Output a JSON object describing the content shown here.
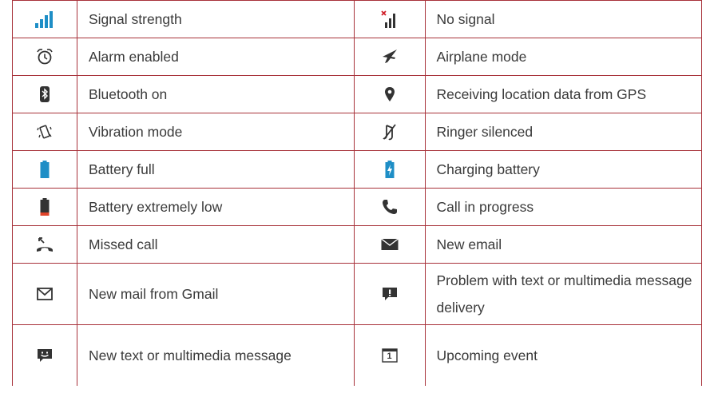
{
  "rows": [
    {
      "left": {
        "icon": "signal-strength-icon",
        "label": "Signal strength"
      },
      "right": {
        "icon": "no-signal-icon",
        "label": "No signal"
      }
    },
    {
      "left": {
        "icon": "alarm-icon",
        "label": "Alarm enabled"
      },
      "right": {
        "icon": "airplane-icon",
        "label": "Airplane mode"
      }
    },
    {
      "left": {
        "icon": "bluetooth-icon",
        "label": "Bluetooth on"
      },
      "right": {
        "icon": "gps-location-icon",
        "label": "Receiving location data from GPS"
      }
    },
    {
      "left": {
        "icon": "vibration-icon",
        "label": "Vibration mode"
      },
      "right": {
        "icon": "ringer-silenced-icon",
        "label": "Ringer silenced"
      }
    },
    {
      "left": {
        "icon": "battery-full-icon",
        "label": "Battery full"
      },
      "right": {
        "icon": "battery-charging-icon",
        "label": "Charging battery"
      }
    },
    {
      "left": {
        "icon": "battery-low-icon",
        "label": "Battery extremely low"
      },
      "right": {
        "icon": "call-in-progress-icon",
        "label": "Call in progress"
      }
    },
    {
      "left": {
        "icon": "missed-call-icon",
        "label": "Missed call"
      },
      "right": {
        "icon": "new-email-icon",
        "label": "New email"
      }
    },
    {
      "left": {
        "icon": "gmail-icon",
        "label": "New mail from Gmail"
      },
      "right": {
        "icon": "message-error-icon",
        "label": "Problem with text or multimedia message delivery"
      }
    },
    {
      "left": {
        "icon": "new-message-icon",
        "label": "New text or multimedia message"
      },
      "right": {
        "icon": "calendar-event-icon",
        "label": "Upcoming event"
      }
    }
  ],
  "calendar_day": "1",
  "colors": {
    "border": "#a8323a",
    "icon_blue": "#1e8ec6",
    "icon_dark": "#333333",
    "battery_low_red": "#e0442a",
    "text": "#3a3a3a",
    "no_signal_x": "#d0202a"
  }
}
